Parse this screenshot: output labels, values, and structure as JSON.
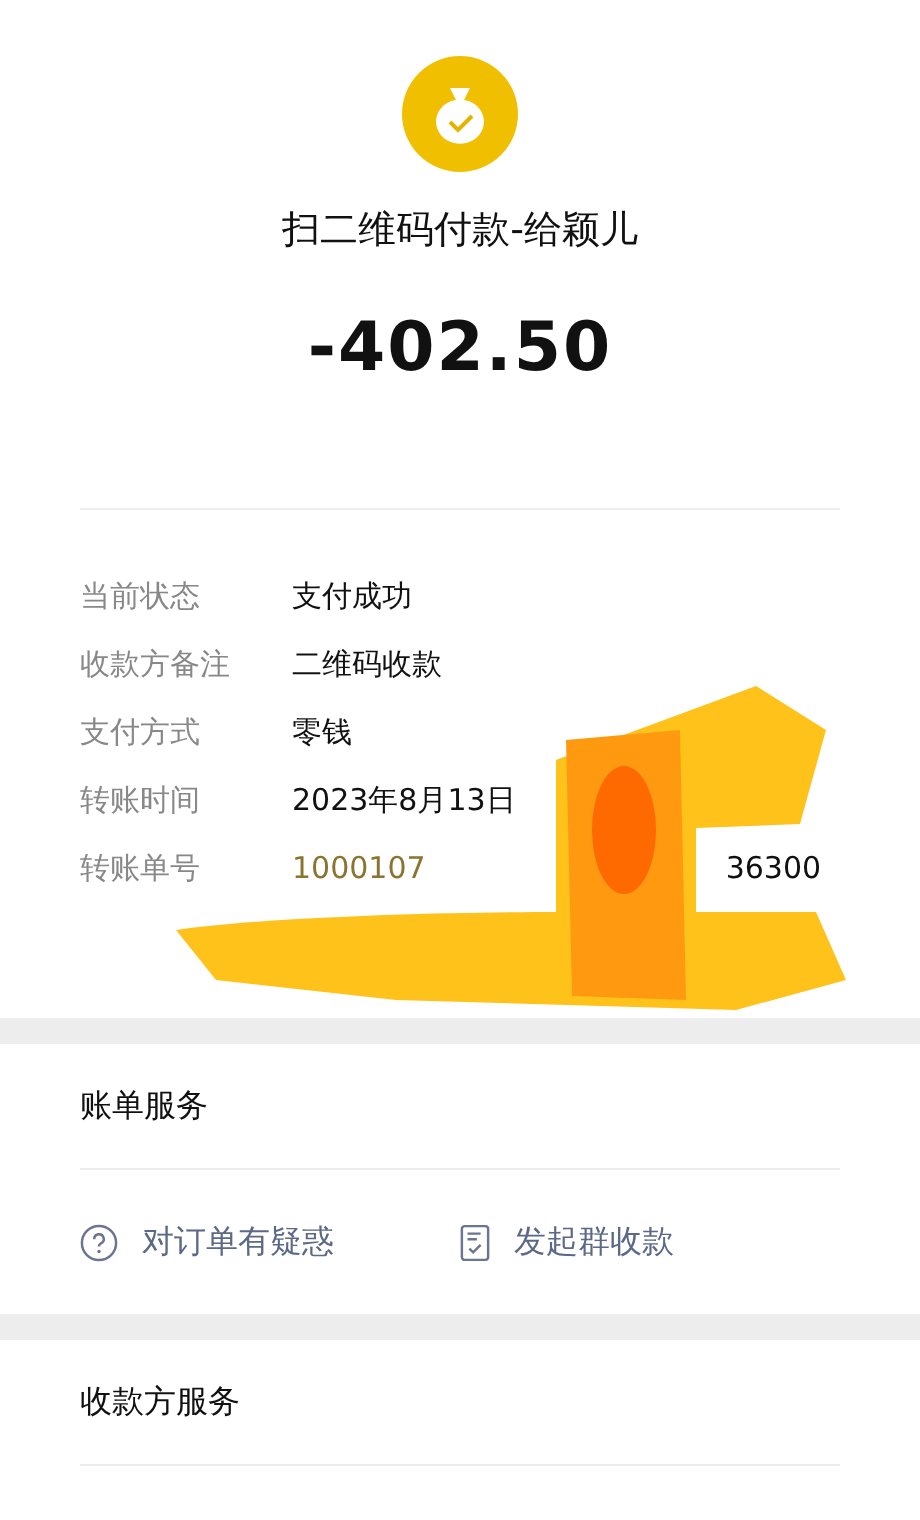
{
  "header": {
    "title": "扫二维码付款-给颖儿",
    "amount": "-402.50"
  },
  "details": [
    {
      "label": "当前状态",
      "value": "支付成功",
      "kind": "text"
    },
    {
      "label": "收款方备注",
      "value": "二维码收款",
      "kind": "text"
    },
    {
      "label": "支付方式",
      "value": "零钱",
      "kind": "text"
    },
    {
      "label": "转账时间",
      "value": "2023年8月13日",
      "kind": "text"
    },
    {
      "label": "转账单号",
      "value_start": "1000107",
      "value_end": "36300",
      "kind": "redacted"
    }
  ],
  "bill_service": {
    "title": "账单服务",
    "actions": [
      {
        "label": "对订单有疑惑",
        "kind": "question"
      },
      {
        "label": "发起群收款",
        "kind": "document"
      }
    ]
  },
  "payee_service": {
    "title": "收款方服务"
  }
}
